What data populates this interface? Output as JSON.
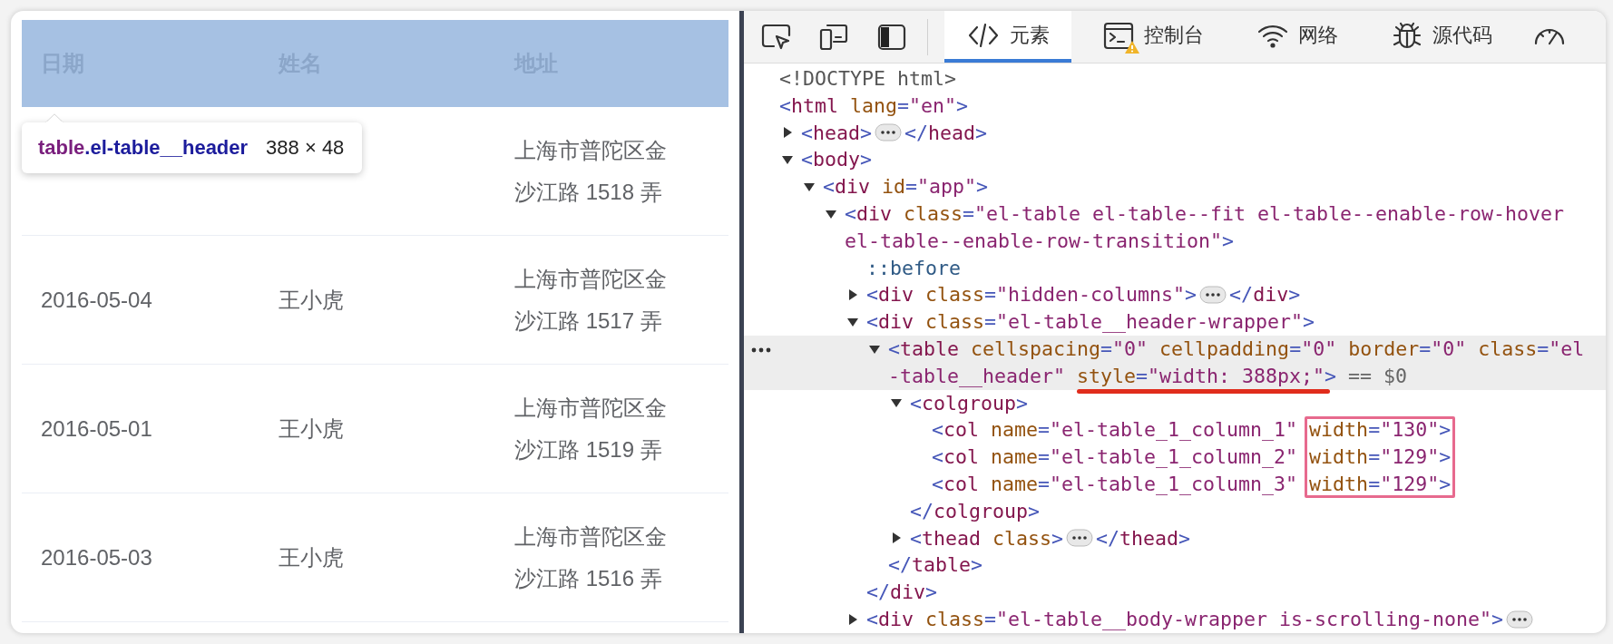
{
  "table": {
    "columns": [
      "日期",
      "姓名",
      "地址"
    ],
    "rows": [
      {
        "address": [
          "上海市普陀区金",
          "沙江路 1518 弄"
        ]
      },
      {
        "date": "2016-05-04",
        "name": "王小虎",
        "address": [
          "上海市普陀区金",
          "沙江路 1517 弄"
        ]
      },
      {
        "date": "2016-05-01",
        "name": "王小虎",
        "address": [
          "上海市普陀区金",
          "沙江路 1519 弄"
        ]
      },
      {
        "date": "2016-05-03",
        "name": "王小虎",
        "address": [
          "上海市普陀区金",
          "沙江路 1516 弄"
        ]
      }
    ]
  },
  "tooltip": {
    "tag": "table",
    "class": ".el-table__header",
    "size": "388 × 48"
  },
  "devtools": {
    "tabs": [
      {
        "label": "元素",
        "selected": true,
        "warning": false
      },
      {
        "label": "控制台",
        "selected": false,
        "warning": true
      },
      {
        "label": "网络",
        "selected": false,
        "warning": false
      },
      {
        "label": "源代码",
        "selected": false,
        "warning": false
      }
    ],
    "dom": [
      {
        "kind": "doctype",
        "open": [
          "<!DOCTYPE html>"
        ],
        "selected": false
      },
      {
        "kind": "element",
        "open": [
          "<html lang=\"en\">"
        ],
        "selected": false,
        "children": [
          {
            "kind": "element",
            "open": [
              "<head>"
            ],
            "expanded": false,
            "close": "</head>",
            "selected": false
          },
          {
            "kind": "element",
            "open": [
              "<body>"
            ],
            "expanded": true,
            "selected": false,
            "children": [
              {
                "kind": "element",
                "open": [
                  "<div id=\"app\">"
                ],
                "expanded": true,
                "selected": false,
                "children": [
                  {
                    "kind": "element",
                    "open": [
                      "<div class=\"el-table el-table--fit el-table--enable-row-hover",
                      "el-table--enable-row-transition\">"
                    ],
                    "expanded": true,
                    "selected": false,
                    "children": [
                      {
                        "kind": "pseudo",
                        "open": [
                          "::before"
                        ],
                        "selected": false
                      },
                      {
                        "kind": "element",
                        "open": [
                          "<div class=\"hidden-columns\">"
                        ],
                        "expanded": false,
                        "close": "</div>",
                        "selected": false
                      },
                      {
                        "kind": "element",
                        "open": [
                          "<div class=\"el-table__header-wrapper\">"
                        ],
                        "expanded": true,
                        "selected": false,
                        "children": [
                          {
                            "kind": "element",
                            "open": [
                              "<table cellspacing=\"0\" cellpadding=\"0\" border=\"0\" class=\"el",
                              [
                                {
                                  "text": "-table__header\" "
                                },
                                {
                                  "text": "style=\"width: 388px;\"",
                                  "underlined": true
                                },
                                {
                                  "text": ">"
                                }
                              ]
                            ],
                            "suffix": "== $0",
                            "expanded": true,
                            "selected": true,
                            "children": [
                              {
                                "kind": "element",
                                "open": [
                                  "<colgroup>"
                                ],
                                "expanded": true,
                                "selected": false,
                                "children": [
                                  {
                                    "kind": "element",
                                    "open": [
                                      [
                                        {
                                          "text": "<col name=\"el-table_1_column_1\" "
                                        },
                                        {
                                          "text": "width=\"130\">",
                                          "boxed": true
                                        }
                                      ]
                                    ],
                                    "selected": false
                                  },
                                  {
                                    "kind": "element",
                                    "open": [
                                      [
                                        {
                                          "text": "<col name=\"el-table_1_column_2\" "
                                        },
                                        {
                                          "text": "width=\"129\">",
                                          "boxed": true
                                        }
                                      ]
                                    ],
                                    "selected": false
                                  },
                                  {
                                    "kind": "element",
                                    "open": [
                                      [
                                        {
                                          "text": "<col name=\"el-table_1_column_3\" "
                                        },
                                        {
                                          "text": "width=\"129\">",
                                          "boxed": true
                                        }
                                      ]
                                    ],
                                    "selected": false
                                  }
                                ],
                                "close": "</colgroup>"
                              },
                              {
                                "kind": "element",
                                "open": [
                                  "<thead class>"
                                ],
                                "expanded": false,
                                "close": "</thead>",
                                "selected": false
                              }
                            ],
                            "close": "</table>"
                          }
                        ],
                        "close": "</div>"
                      },
                      {
                        "kind": "element",
                        "open": [
                          "<div class=\"el-table__body-wrapper is-scrolling-none\">"
                        ],
                        "expanded": false,
                        "selected": false
                      }
                    ]
                  }
                ]
              }
            ]
          }
        ]
      }
    ]
  }
}
